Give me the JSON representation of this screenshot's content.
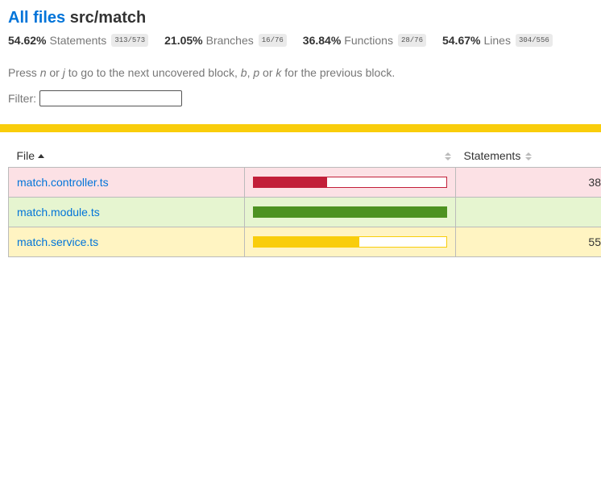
{
  "header": {
    "root_link": "All files",
    "path": "src/match"
  },
  "summary": [
    {
      "pct": "54.62%",
      "label": "Statements",
      "frac": "313/573"
    },
    {
      "pct": "21.05%",
      "label": "Branches",
      "frac": "16/76"
    },
    {
      "pct": "36.84%",
      "label": "Functions",
      "frac": "28/76"
    },
    {
      "pct": "54.67%",
      "label": "Lines",
      "frac": "304/556"
    }
  ],
  "hint": {
    "p1": "Press ",
    "k1": "n",
    "p2": " or ",
    "k2": "j",
    "p3": " to go to the next uncovered block, ",
    "k3": "b",
    "p4": ", ",
    "k4": "p",
    "p5": " or ",
    "k5": "k",
    "p6": " for the previous block."
  },
  "filter": {
    "label": "Filter:",
    "value": ""
  },
  "colors": {
    "status_line": "#f9cd0b",
    "low_bar": "#C21F39",
    "high_bar": "#4D9221",
    "medium_bar": "#F9CD0B",
    "link": "#0074D9"
  },
  "table": {
    "columns": {
      "file": "File",
      "statements": "Statements"
    },
    "rows": [
      {
        "file": "match.controller.ts",
        "level": "low",
        "pct": 38,
        "stmt_text": "38"
      },
      {
        "file": "match.module.ts",
        "level": "high",
        "pct": 100,
        "stmt_text": ""
      },
      {
        "file": "match.service.ts",
        "level": "medium",
        "pct": 55,
        "stmt_text": "55"
      }
    ]
  }
}
